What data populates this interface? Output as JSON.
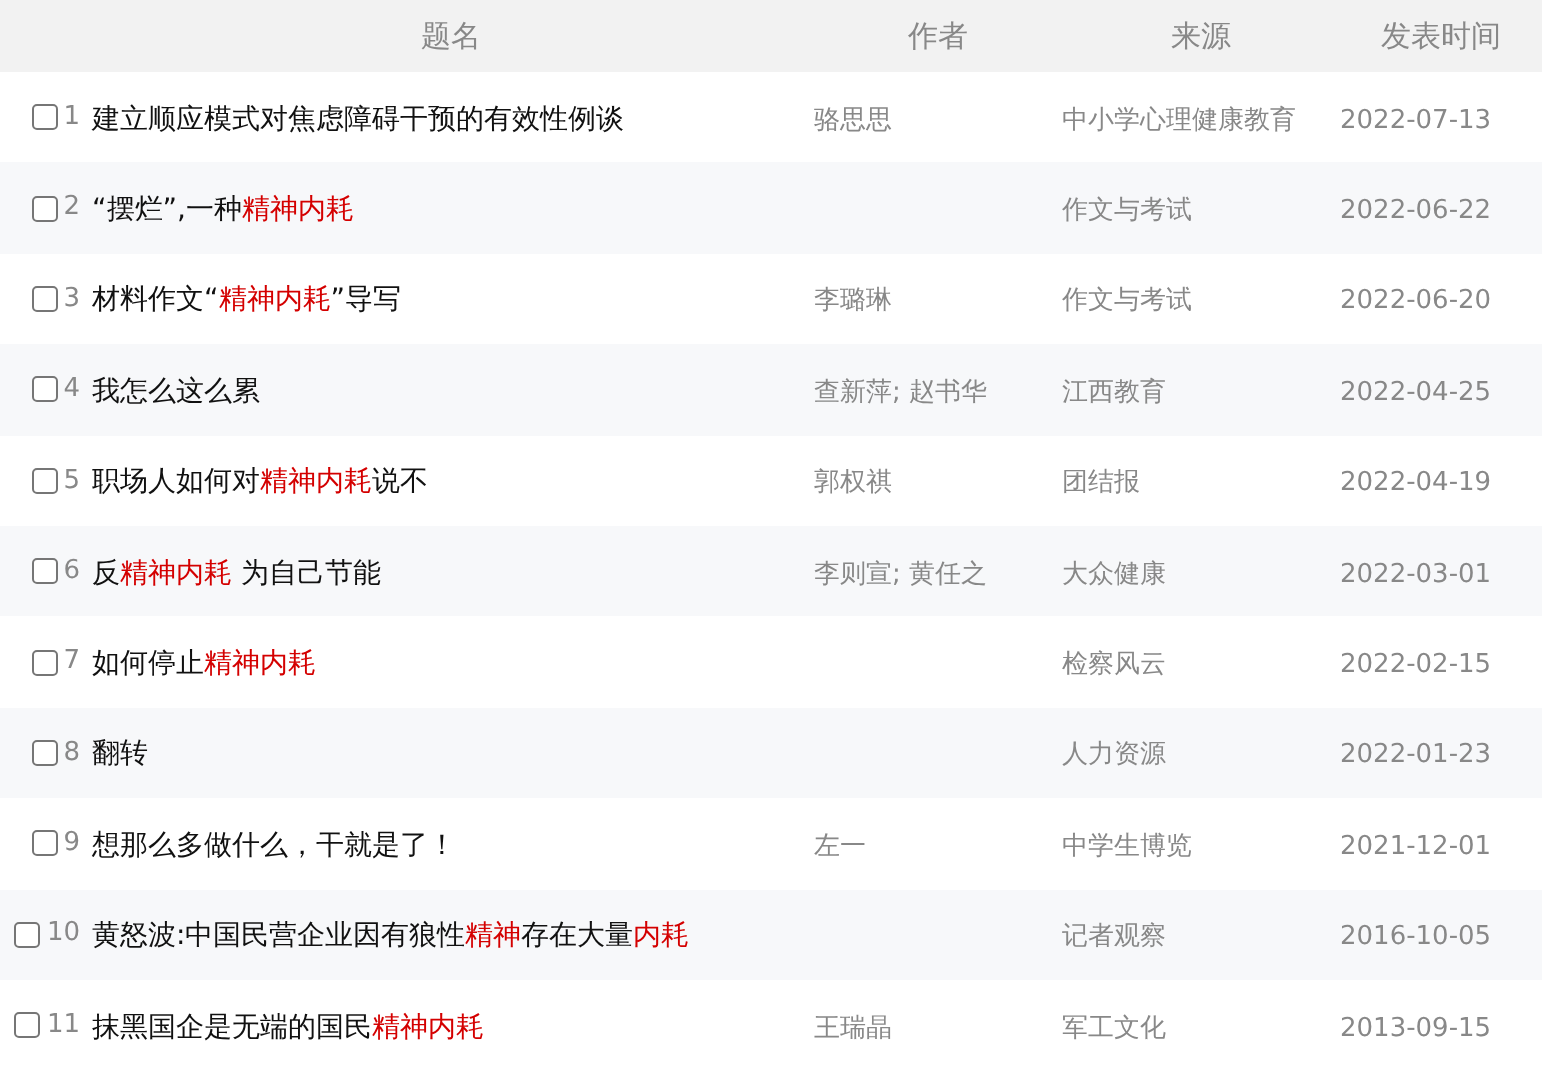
{
  "columns": [
    "题名",
    "作者",
    "来源",
    "发表时间"
  ],
  "rows": [
    {
      "checked": false,
      "index": "1",
      "title": [
        {
          "text": "建立顺应模式对焦虑障碍干预的有效性例谈",
          "highlight": false
        }
      ],
      "author": "骆思思",
      "source": "中小学心理健康教育",
      "date": "2022-07-13"
    },
    {
      "checked": false,
      "index": "2",
      "title": [
        {
          "text": "“摆烂”,一种",
          "highlight": false
        },
        {
          "text": "精神内耗",
          "highlight": true
        }
      ],
      "author": "",
      "source": "作文与考试",
      "date": "2022-06-22"
    },
    {
      "checked": false,
      "index": "3",
      "title": [
        {
          "text": "材料作文“",
          "highlight": false
        },
        {
          "text": "精神内耗",
          "highlight": true
        },
        {
          "text": "”导写",
          "highlight": false
        }
      ],
      "author": "李璐琳",
      "source": "作文与考试",
      "date": "2022-06-20"
    },
    {
      "checked": false,
      "index": "4",
      "title": [
        {
          "text": "我怎么这么累",
          "highlight": false
        }
      ],
      "author": "查新萍; 赵书华",
      "source": "江西教育",
      "date": "2022-04-25"
    },
    {
      "checked": false,
      "index": "5",
      "title": [
        {
          "text": "职场人如何对",
          "highlight": false
        },
        {
          "text": "精神内耗",
          "highlight": true
        },
        {
          "text": "说不",
          "highlight": false
        }
      ],
      "author": "郭权祺",
      "source": "团结报",
      "date": "2022-04-19"
    },
    {
      "checked": false,
      "index": "6",
      "title": [
        {
          "text": "反",
          "highlight": false
        },
        {
          "text": "精神内耗",
          "highlight": true
        },
        {
          "text": " 为自己节能",
          "highlight": false
        }
      ],
      "author": "李则宣; 黄任之",
      "source": "大众健康",
      "date": "2022-03-01"
    },
    {
      "checked": false,
      "index": "7",
      "title": [
        {
          "text": "如何停止",
          "highlight": false
        },
        {
          "text": "精神内耗",
          "highlight": true
        }
      ],
      "author": "",
      "source": "检察风云",
      "date": "2022-02-15"
    },
    {
      "checked": false,
      "index": "8",
      "title": [
        {
          "text": "翻转",
          "highlight": false
        }
      ],
      "author": "",
      "source": "人力资源",
      "date": "2022-01-23"
    },
    {
      "checked": false,
      "index": "9",
      "title": [
        {
          "text": "想那么多做什么，干就是了！",
          "highlight": false
        }
      ],
      "author": "左一",
      "source": "中学生博览",
      "date": "2021-12-01"
    },
    {
      "checked": false,
      "index": "10",
      "title": [
        {
          "text": "黄怒波:中国民营企业因有狼性",
          "highlight": false
        },
        {
          "text": "精神",
          "highlight": true
        },
        {
          "text": "存在大量",
          "highlight": false
        },
        {
          "text": "内耗",
          "highlight": true
        }
      ],
      "author": "",
      "source": "记者观察",
      "date": "2016-10-05"
    },
    {
      "checked": false,
      "index": "11",
      "title": [
        {
          "text": "抹黑国企是无端的国民",
          "highlight": false
        },
        {
          "text": "精神内耗",
          "highlight": true
        }
      ],
      "author": "王瑞晶",
      "source": "军工文化",
      "date": "2013-09-15"
    }
  ]
}
